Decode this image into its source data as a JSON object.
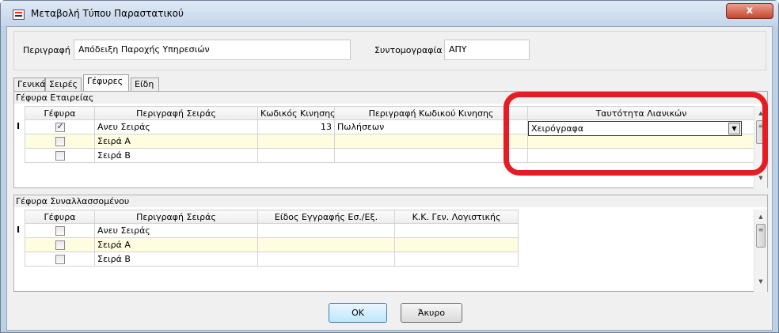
{
  "window": {
    "title": "Μεταβολή Τύπου Παραστατικού",
    "close_label": "x"
  },
  "header": {
    "description_label": "Περιγραφή",
    "description_value": "Απόδειξη Παροχής Υπηρεσιών",
    "abbrev_label": "Συντομογραφία",
    "abbrev_value": "ΑΠΥ"
  },
  "tabs": [
    {
      "label": "Γενικά"
    },
    {
      "label": "Σειρές"
    },
    {
      "label": "Γέφυρες"
    },
    {
      "label": "Είδη"
    }
  ],
  "company_bridge": {
    "title": "Γέφυρα Εταιρείας",
    "columns": [
      "Γέφυρα",
      "Περιγραφή Σειράς",
      "Κωδικός Κινησης",
      "Περιγραφή Κωδικού Κινησης",
      "Ταυτότητα Λιανικών"
    ],
    "rows": [
      {
        "checked": true,
        "series": "Ανευ Σειράς",
        "code": "13",
        "code_desc": "Πωλήσεων",
        "retail_id": "Χειρόγραφα"
      },
      {
        "checked": false,
        "series": "Σειρά Α",
        "code": "",
        "code_desc": "",
        "retail_id": ""
      },
      {
        "checked": false,
        "series": "Σειρά Β",
        "code": "",
        "code_desc": "",
        "retail_id": ""
      }
    ]
  },
  "partner_bridge": {
    "title": "Γέφυρα Συναλλασσομένου",
    "columns": [
      "Γέφυρα",
      "Περιγραφή Σειράς",
      "Είδος Εγγραφής Εσ./Εξ.",
      "Κ.Κ. Γεν. Λογιστικής"
    ],
    "rows": [
      {
        "checked": false,
        "series": "Ανευ Σειράς",
        "entry_type": "",
        "gl_code": ""
      },
      {
        "checked": false,
        "series": "Σειρά Α",
        "entry_type": "",
        "gl_code": ""
      },
      {
        "checked": false,
        "series": "Σειρά Β",
        "entry_type": "",
        "gl_code": ""
      }
    ]
  },
  "row_indicator": "I",
  "buttons": {
    "ok": "OK",
    "cancel": "Άκυρο"
  },
  "colors": {
    "highlight": "#e51c23",
    "alt_row": "#fffde0"
  }
}
